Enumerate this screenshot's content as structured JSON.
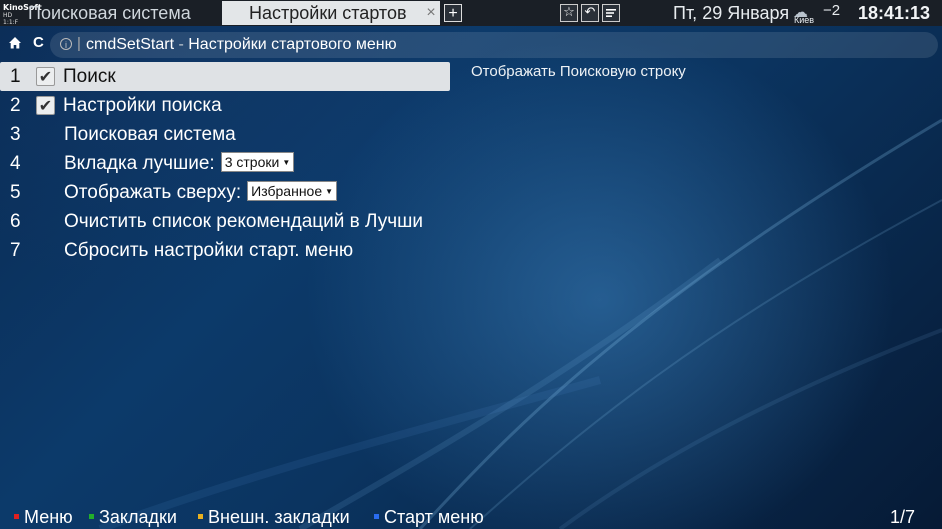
{
  "topbar": {
    "logo_line1": "KinoSoft",
    "logo_line2": "HD 1:1:F",
    "tab1_title": "Поисковая система",
    "tab2_title": "Настройки стартов",
    "tab2_close": "×",
    "new_tab": "+",
    "tools": [
      "star-icon",
      "undo-icon",
      "menu-icon"
    ],
    "date": "Пт, 29 Января",
    "weather_city": "Киев",
    "weather_icon": "cloud-sun-icon",
    "temperature": "−2",
    "clock": "18:41:13"
  },
  "address": {
    "command": "cmdSetStart",
    "separator": " - ",
    "page_title": "Настройки стартового меню",
    "divider": "|"
  },
  "menu": {
    "items": [
      {
        "num": "1",
        "label": "Поиск",
        "checked": true
      },
      {
        "num": "2",
        "label": "Настройки поиска",
        "checked": true
      },
      {
        "num": "3",
        "label": "Поисковая система"
      },
      {
        "num": "4",
        "label": "Вкладка лучшие:",
        "select": "3 строки"
      },
      {
        "num": "5",
        "label": "Отображать сверху:",
        "select": "Избранное"
      },
      {
        "num": "6",
        "label": "Очистить список рекомендаций в Лучши"
      },
      {
        "num": "7",
        "label": "Сбросить настройки старт. меню"
      }
    ],
    "selected_index": 0
  },
  "description": "Отображать Поисковую строку",
  "bottom": {
    "items": [
      {
        "label": "Меню",
        "color": "#e02020"
      },
      {
        "label": "Закладки",
        "color": "#22b02a"
      },
      {
        "label": "Внешн. закладки",
        "color": "#e8b020"
      },
      {
        "label": "Старт меню",
        "color": "#2a6cf0"
      }
    ],
    "pager": "1/7"
  }
}
